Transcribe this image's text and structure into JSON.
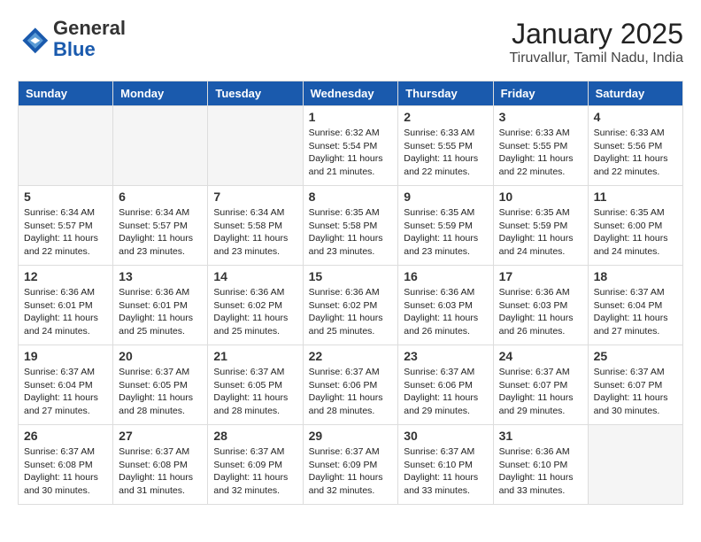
{
  "header": {
    "logo_line1": "General",
    "logo_line2": "Blue",
    "title": "January 2025",
    "subtitle": "Tiruvallur, Tamil Nadu, India"
  },
  "days_of_week": [
    "Sunday",
    "Monday",
    "Tuesday",
    "Wednesday",
    "Thursday",
    "Friday",
    "Saturday"
  ],
  "weeks": [
    [
      {
        "day": "",
        "info": ""
      },
      {
        "day": "",
        "info": ""
      },
      {
        "day": "",
        "info": ""
      },
      {
        "day": "1",
        "info": "Sunrise: 6:32 AM\nSunset: 5:54 PM\nDaylight: 11 hours\nand 21 minutes."
      },
      {
        "day": "2",
        "info": "Sunrise: 6:33 AM\nSunset: 5:55 PM\nDaylight: 11 hours\nand 22 minutes."
      },
      {
        "day": "3",
        "info": "Sunrise: 6:33 AM\nSunset: 5:55 PM\nDaylight: 11 hours\nand 22 minutes."
      },
      {
        "day": "4",
        "info": "Sunrise: 6:33 AM\nSunset: 5:56 PM\nDaylight: 11 hours\nand 22 minutes."
      }
    ],
    [
      {
        "day": "5",
        "info": "Sunrise: 6:34 AM\nSunset: 5:57 PM\nDaylight: 11 hours\nand 22 minutes."
      },
      {
        "day": "6",
        "info": "Sunrise: 6:34 AM\nSunset: 5:57 PM\nDaylight: 11 hours\nand 23 minutes."
      },
      {
        "day": "7",
        "info": "Sunrise: 6:34 AM\nSunset: 5:58 PM\nDaylight: 11 hours\nand 23 minutes."
      },
      {
        "day": "8",
        "info": "Sunrise: 6:35 AM\nSunset: 5:58 PM\nDaylight: 11 hours\nand 23 minutes."
      },
      {
        "day": "9",
        "info": "Sunrise: 6:35 AM\nSunset: 5:59 PM\nDaylight: 11 hours\nand 23 minutes."
      },
      {
        "day": "10",
        "info": "Sunrise: 6:35 AM\nSunset: 5:59 PM\nDaylight: 11 hours\nand 24 minutes."
      },
      {
        "day": "11",
        "info": "Sunrise: 6:35 AM\nSunset: 6:00 PM\nDaylight: 11 hours\nand 24 minutes."
      }
    ],
    [
      {
        "day": "12",
        "info": "Sunrise: 6:36 AM\nSunset: 6:01 PM\nDaylight: 11 hours\nand 24 minutes."
      },
      {
        "day": "13",
        "info": "Sunrise: 6:36 AM\nSunset: 6:01 PM\nDaylight: 11 hours\nand 25 minutes."
      },
      {
        "day": "14",
        "info": "Sunrise: 6:36 AM\nSunset: 6:02 PM\nDaylight: 11 hours\nand 25 minutes."
      },
      {
        "day": "15",
        "info": "Sunrise: 6:36 AM\nSunset: 6:02 PM\nDaylight: 11 hours\nand 25 minutes."
      },
      {
        "day": "16",
        "info": "Sunrise: 6:36 AM\nSunset: 6:03 PM\nDaylight: 11 hours\nand 26 minutes."
      },
      {
        "day": "17",
        "info": "Sunrise: 6:36 AM\nSunset: 6:03 PM\nDaylight: 11 hours\nand 26 minutes."
      },
      {
        "day": "18",
        "info": "Sunrise: 6:37 AM\nSunset: 6:04 PM\nDaylight: 11 hours\nand 27 minutes."
      }
    ],
    [
      {
        "day": "19",
        "info": "Sunrise: 6:37 AM\nSunset: 6:04 PM\nDaylight: 11 hours\nand 27 minutes."
      },
      {
        "day": "20",
        "info": "Sunrise: 6:37 AM\nSunset: 6:05 PM\nDaylight: 11 hours\nand 28 minutes."
      },
      {
        "day": "21",
        "info": "Sunrise: 6:37 AM\nSunset: 6:05 PM\nDaylight: 11 hours\nand 28 minutes."
      },
      {
        "day": "22",
        "info": "Sunrise: 6:37 AM\nSunset: 6:06 PM\nDaylight: 11 hours\nand 28 minutes."
      },
      {
        "day": "23",
        "info": "Sunrise: 6:37 AM\nSunset: 6:06 PM\nDaylight: 11 hours\nand 29 minutes."
      },
      {
        "day": "24",
        "info": "Sunrise: 6:37 AM\nSunset: 6:07 PM\nDaylight: 11 hours\nand 29 minutes."
      },
      {
        "day": "25",
        "info": "Sunrise: 6:37 AM\nSunset: 6:07 PM\nDaylight: 11 hours\nand 30 minutes."
      }
    ],
    [
      {
        "day": "26",
        "info": "Sunrise: 6:37 AM\nSunset: 6:08 PM\nDaylight: 11 hours\nand 30 minutes."
      },
      {
        "day": "27",
        "info": "Sunrise: 6:37 AM\nSunset: 6:08 PM\nDaylight: 11 hours\nand 31 minutes."
      },
      {
        "day": "28",
        "info": "Sunrise: 6:37 AM\nSunset: 6:09 PM\nDaylight: 11 hours\nand 32 minutes."
      },
      {
        "day": "29",
        "info": "Sunrise: 6:37 AM\nSunset: 6:09 PM\nDaylight: 11 hours\nand 32 minutes."
      },
      {
        "day": "30",
        "info": "Sunrise: 6:37 AM\nSunset: 6:10 PM\nDaylight: 11 hours\nand 33 minutes."
      },
      {
        "day": "31",
        "info": "Sunrise: 6:36 AM\nSunset: 6:10 PM\nDaylight: 11 hours\nand 33 minutes."
      },
      {
        "day": "",
        "info": ""
      }
    ]
  ]
}
